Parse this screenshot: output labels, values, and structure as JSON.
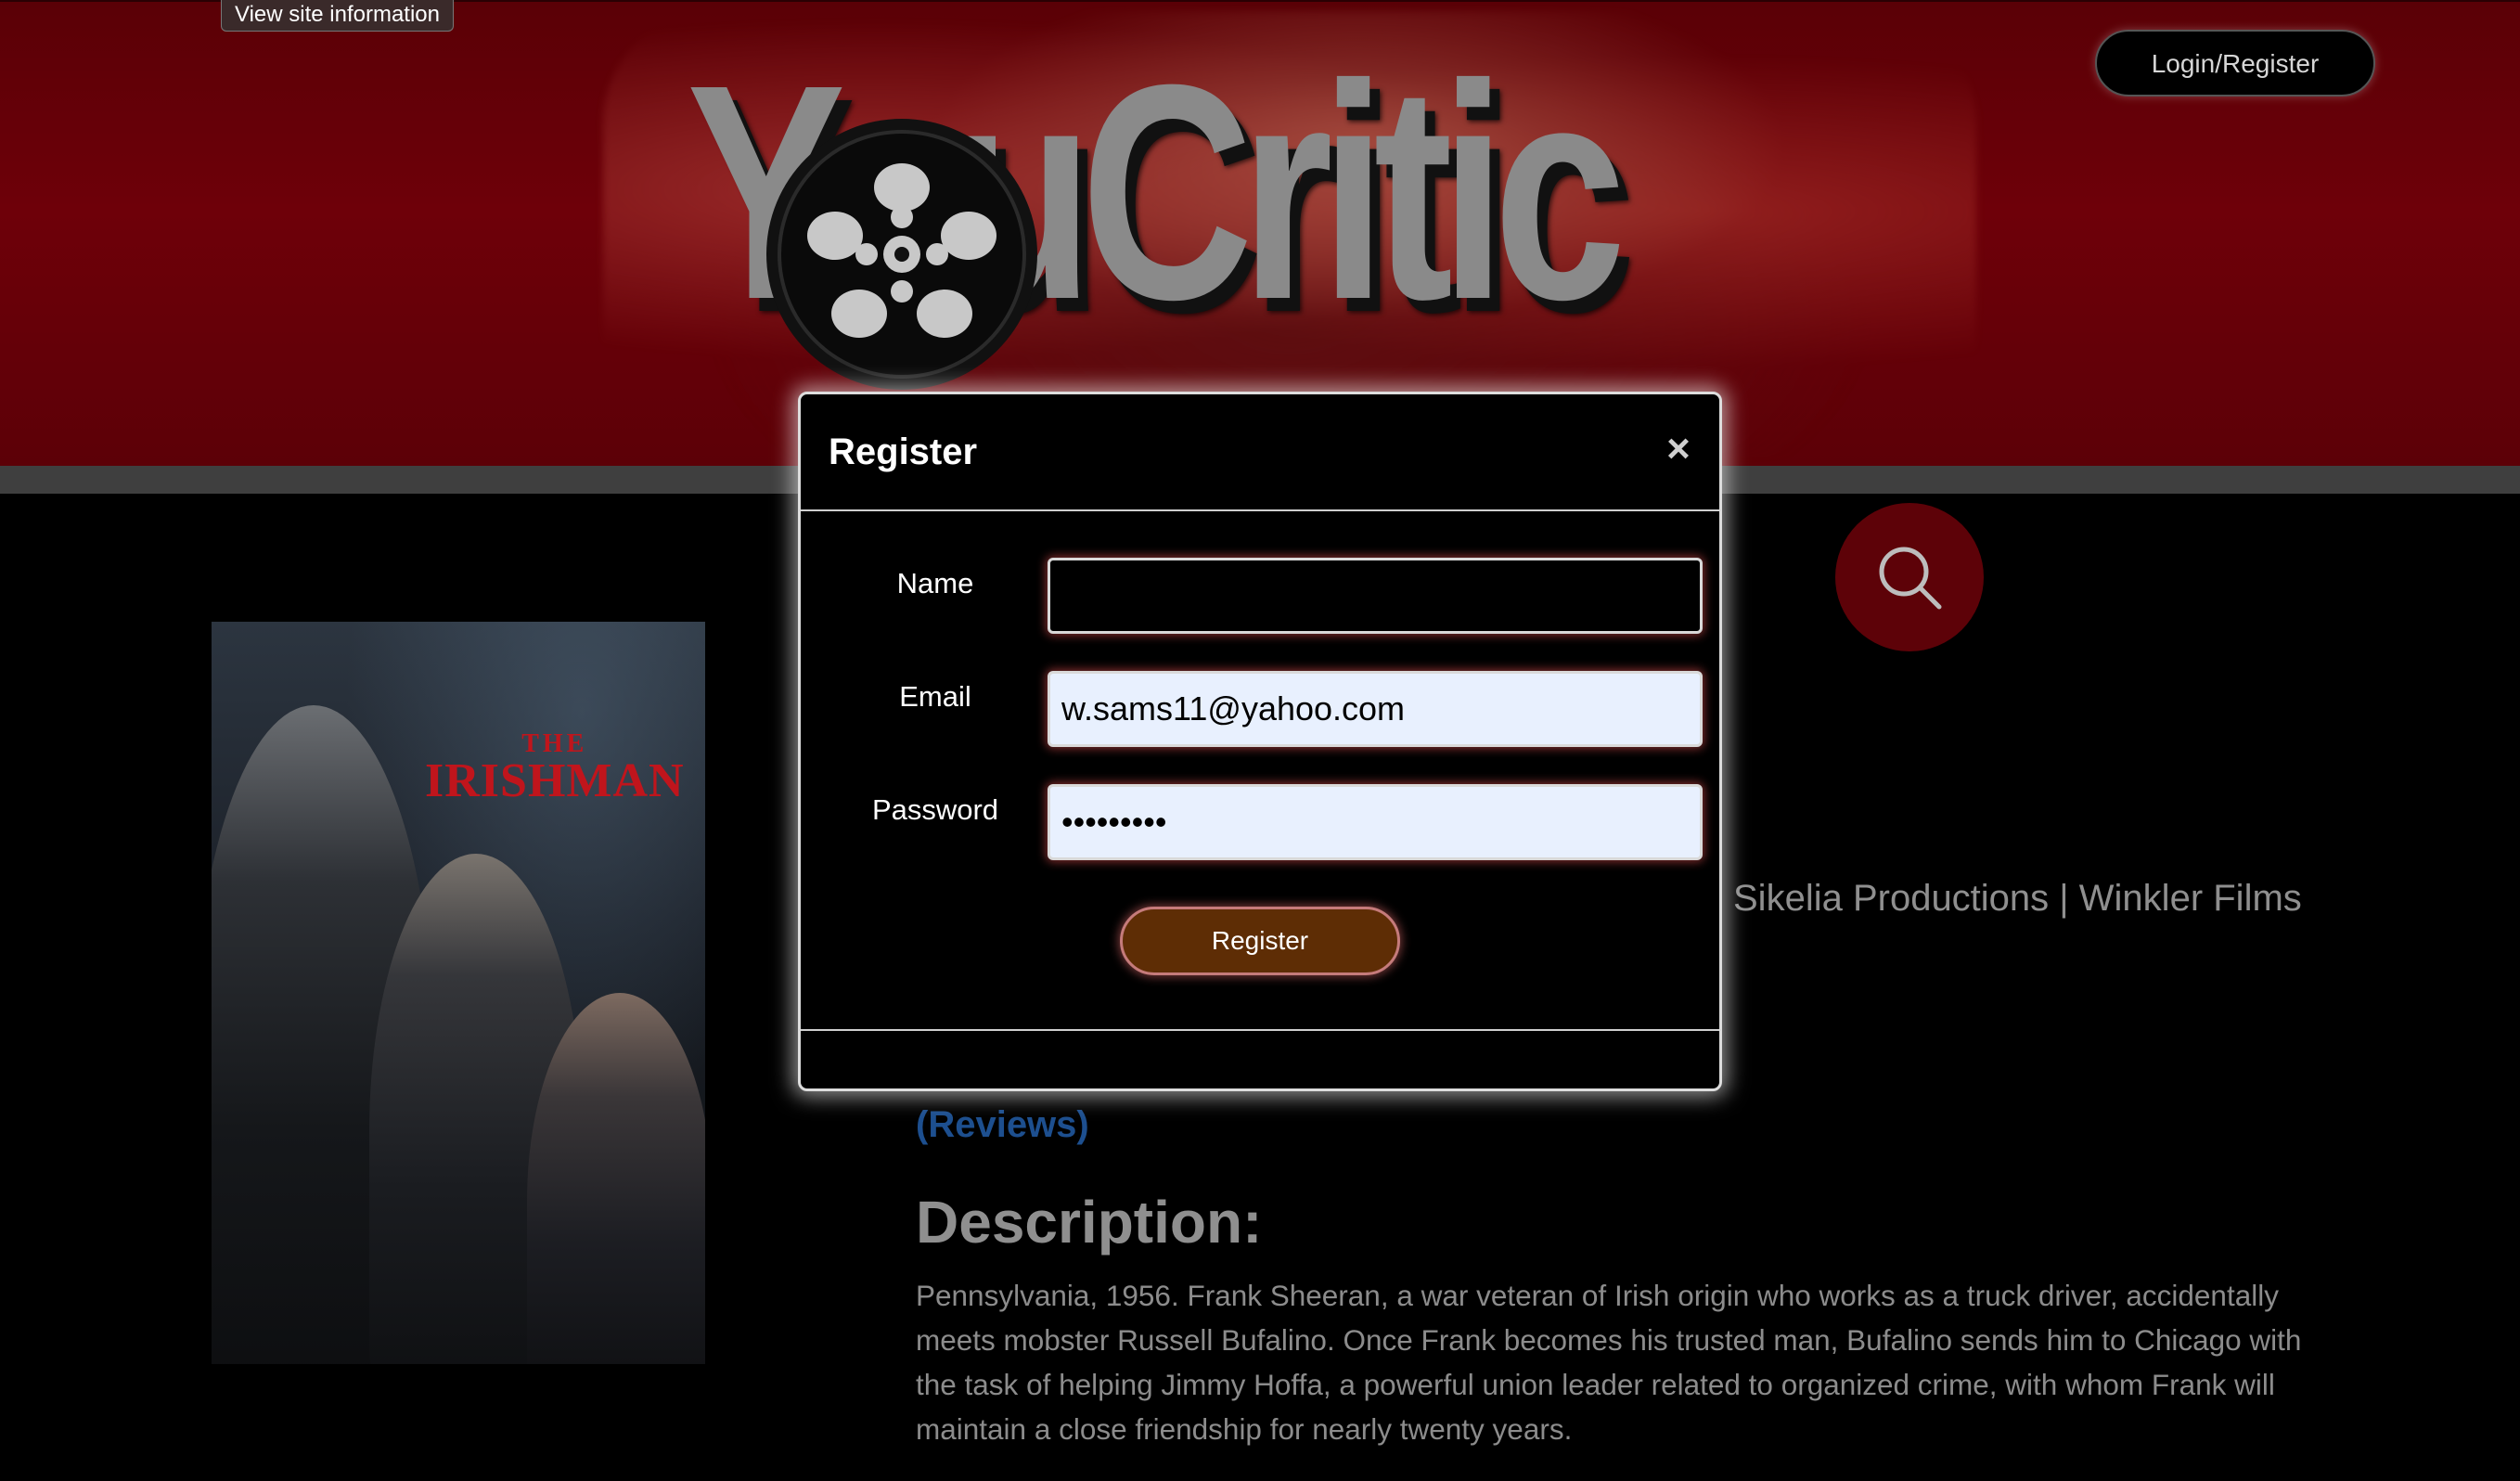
{
  "browser": {
    "site_info_tooltip": "View site information"
  },
  "header": {
    "logo_text": "YouCritic",
    "login_register_label": "Login/Register"
  },
  "movie": {
    "poster_title_small": "THE",
    "poster_title_big": "IRISHMAN",
    "studios_text": "Sikelia Productions | Winkler Films",
    "reviews_link": "(Reviews)",
    "description_heading": "Description:",
    "description_text": "Pennsylvania, 1956. Frank Sheeran, a war veteran of Irish origin who works as a truck driver, accidentally meets mobster Russell Bufalino. Once Frank becomes his trusted man, Bufalino sends him to Chicago with the task of helping Jimmy Hoffa, a powerful union leader related to organized crime, with whom Frank will maintain a close friendship for nearly twenty years."
  },
  "modal": {
    "title": "Register",
    "close_glyph": "×",
    "fields": {
      "name_label": "Name",
      "name_value": "",
      "email_label": "Email",
      "email_value": "w.sams11@yahoo.com",
      "password_label": "Password",
      "password_value": "123456789"
    },
    "submit_label": "Register"
  },
  "icons": {
    "search": "search-icon",
    "close": "close-icon",
    "film_reel": "film-reel-icon"
  },
  "colors": {
    "banner_red": "#6e0009",
    "search_circle": "#5d0208",
    "register_button": "#5e2d05",
    "reviews_link": "#1d4f8f",
    "autofill_background": "#e8f0fe"
  }
}
